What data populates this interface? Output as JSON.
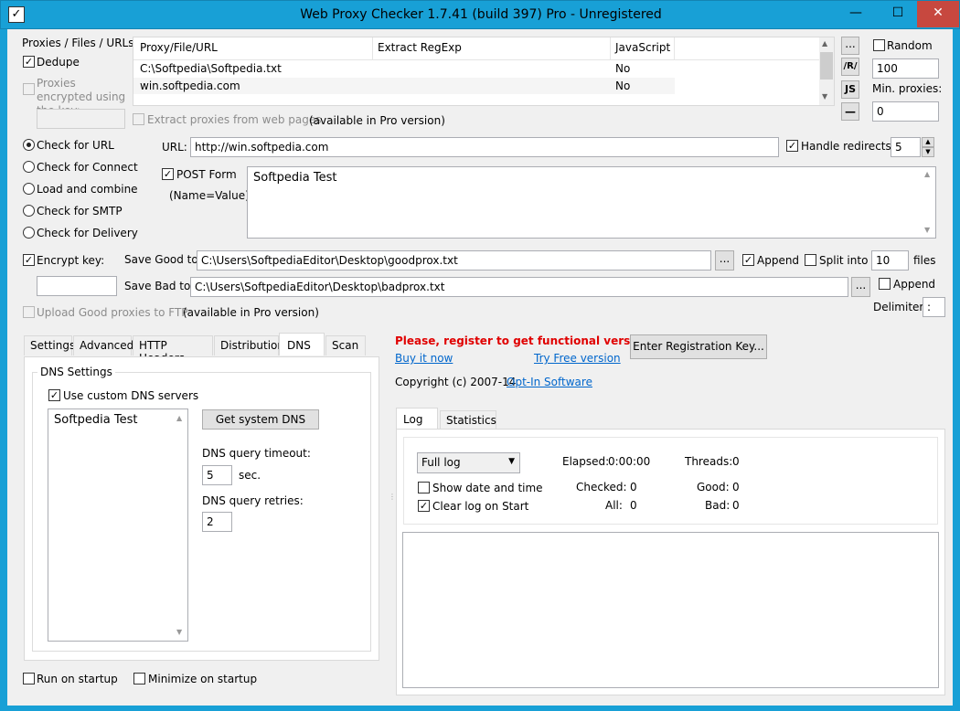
{
  "window": {
    "title": "Web Proxy Checker 1.7.41 (build 397) Pro - Unregistered",
    "minimize": "—",
    "maximize": "☐",
    "close": "✕"
  },
  "proxies": {
    "label": "Proxies / Files / URLs:",
    "dedupe": "Dedupe",
    "encrypted": "Proxies encrypted using the key:",
    "extract": "Extract proxies from web pages",
    "extract_note": "(available in Pro version)",
    "columns": [
      "Proxy/File/URL",
      "Extract RegExp",
      "JavaScript"
    ],
    "rows": [
      {
        "url": "C:\\Softpedia\\Softpedia.txt",
        "regexp": "",
        "js": "No"
      },
      {
        "url": "win.softpedia.com",
        "regexp": "",
        "js": "No"
      }
    ],
    "side_buttons": [
      "...",
      "/R/",
      "JS",
      "—"
    ],
    "random": "Random",
    "random_value": "100",
    "min_proxies": "Min. proxies:",
    "min_value": "0"
  },
  "modes": [
    "Check for URL",
    "Check for Connect",
    "Load and combine",
    "Check for SMTP",
    "Check for Delivery"
  ],
  "url": {
    "label": "URL:",
    "value": "http://win.softpedia.com",
    "handle_redirects": "Handle redirects",
    "redirects_value": "5"
  },
  "post": {
    "label": "POST Form",
    "sub": "(Name=Value)",
    "value": "Softpedia Test"
  },
  "save": {
    "encrypt": "Encrypt key:",
    "good_label": "Save Good to:",
    "good_value": "C:\\Users\\SoftpediaEditor\\Desktop\\goodprox.txt",
    "bad_label": "Save Bad to:",
    "bad_value": "C:\\Users\\SoftpediaEditor\\Desktop\\badprox.txt",
    "browse": "...",
    "append": "Append",
    "split": "Split into",
    "split_value": "10",
    "files": "files",
    "append2": "Append",
    "delimiter": "Delimiter:",
    "delimiter_value": ":",
    "ftp": "Upload Good proxies to FTP",
    "ftp_note": "(available in Pro version)"
  },
  "tabs": [
    "Settings",
    "Advanced",
    "HTTP Headers",
    "Distribution",
    "DNS",
    "Scan"
  ],
  "dns": {
    "group": "DNS Settings",
    "use_custom": "Use custom DNS servers",
    "servers": [
      "Softpedia Test"
    ],
    "get_system": "Get system DNS",
    "timeout_label": "DNS query timeout:",
    "timeout_value": "5",
    "sec": "sec.",
    "retries_label": "DNS query retries:",
    "retries_value": "2"
  },
  "register": {
    "warning": "Please, register to get functional version!",
    "buy": "Buy it now",
    "try": "Try Free version",
    "copyright": "Copyright (c) 2007-14",
    "company": "Opt-In Software",
    "enter_key": "Enter Registration Key..."
  },
  "log": {
    "tabs": [
      "Log",
      "Statistics"
    ],
    "mode": "Full log",
    "show_date": "Show date and time",
    "clear": "Clear log on Start",
    "elapsed_label": "Elapsed:",
    "elapsed": "0:00:00",
    "threads_label": "Threads:",
    "threads": "0",
    "checked_label": "Checked:",
    "checked": "0",
    "good_label": "Good:",
    "good": "0",
    "all_label": "All:",
    "all": "0",
    "bad_label": "Bad:",
    "bad": "0"
  },
  "footer": {
    "run": "Run on startup",
    "minimize": "Minimize on startup"
  }
}
